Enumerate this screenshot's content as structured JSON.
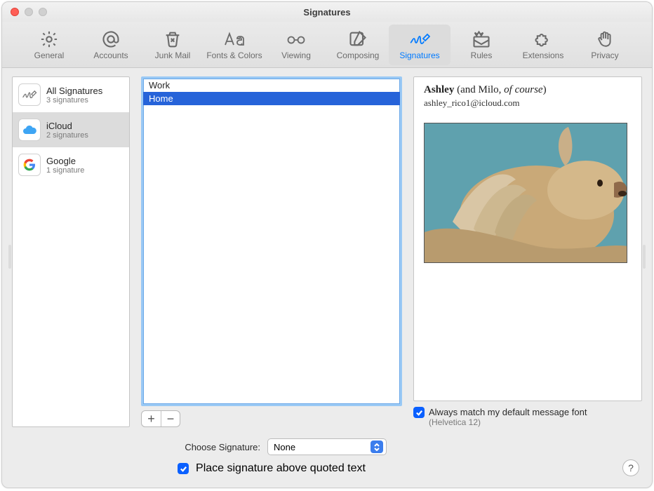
{
  "window": {
    "title": "Signatures"
  },
  "toolbar": [
    {
      "label": "General",
      "icon": "gear-icon"
    },
    {
      "label": "Accounts",
      "icon": "at-icon"
    },
    {
      "label": "Junk Mail",
      "icon": "trash-icon"
    },
    {
      "label": "Fonts & Colors",
      "icon": "fonts-icon"
    },
    {
      "label": "Viewing",
      "icon": "glasses-icon"
    },
    {
      "label": "Composing",
      "icon": "compose-icon"
    },
    {
      "label": "Signatures",
      "icon": "signature-icon",
      "selected": true
    },
    {
      "label": "Rules",
      "icon": "rules-icon"
    },
    {
      "label": "Extensions",
      "icon": "puzzle-icon"
    },
    {
      "label": "Privacy",
      "icon": "hand-icon"
    }
  ],
  "accounts": [
    {
      "name": "All Signatures",
      "sub": "3 signatures",
      "icon": "signature-icon"
    },
    {
      "name": "iCloud",
      "sub": "2 signatures",
      "icon": "icloud-icon",
      "selected": true
    },
    {
      "name": "Google",
      "sub": "1 signature",
      "icon": "google-icon"
    }
  ],
  "signatures": [
    {
      "name": "Work"
    },
    {
      "name": "Home",
      "selected": true
    }
  ],
  "preview": {
    "line_name_bold": "Ashley",
    "line_name_plain": " (and Milo, ",
    "line_name_italic": "of course",
    "line_name_tail": ")",
    "email": "ashley_rico1@icloud.com"
  },
  "options": {
    "match_font_label": "Always match my default message font",
    "match_font_sub": "(Helvetica 12)",
    "choose_label": "Choose Signature:",
    "choose_value": "None",
    "place_above_label": "Place signature above quoted text"
  },
  "buttons": {
    "add": "+",
    "remove": "−"
  }
}
